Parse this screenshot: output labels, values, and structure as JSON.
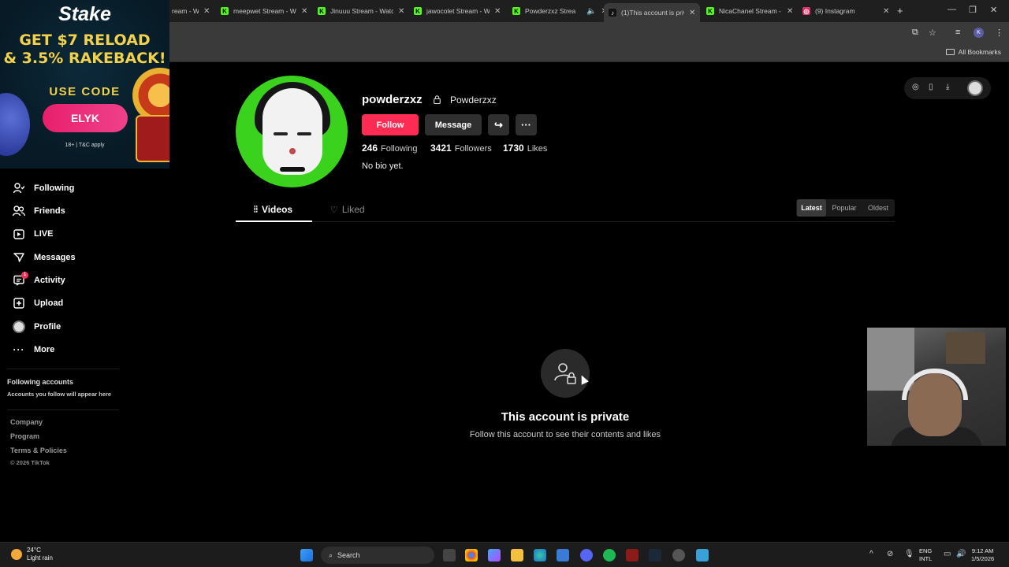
{
  "browser": {
    "tabs": [
      {
        "title": "ream - W",
        "fav_color": "#53fc18",
        "fav_glyph": ""
      },
      {
        "title": "meepwet Stream - W",
        "fav_color": "#53fc18",
        "fav_glyph": "K"
      },
      {
        "title": "Jinuuu Stream - Watc",
        "fav_color": "#53fc18",
        "fav_glyph": "K"
      },
      {
        "title": "jawocolet Stream - W",
        "fav_color": "#53fc18",
        "fav_glyph": "K"
      },
      {
        "title": "Powderzxz Strea",
        "fav_color": "#53fc18",
        "fav_glyph": "K"
      },
      {
        "title": "(1)This account is priv",
        "fav_color": "#000000",
        "fav_glyph": "♪"
      },
      {
        "title": "NicaChanel Stream -",
        "fav_color": "#53fc18",
        "fav_glyph": "K"
      },
      {
        "title": "(9) Instagram",
        "fav_color": "#e1306c",
        "fav_glyph": "◎"
      }
    ],
    "new_tab": "+",
    "all_bookmarks": "All Bookmarks",
    "avatar_letter": "K"
  },
  "ad": {
    "brand": "Stake",
    "headline_1": "GET $7 RELOAD",
    "headline_2": "& 3.5% RAKEBACK!",
    "code_label": "USE CODE",
    "code": "ELYK",
    "fine_print": "18+ | T&C apply"
  },
  "sidebar": {
    "items": [
      {
        "label": "Following",
        "icon": "following-icon"
      },
      {
        "label": "Friends",
        "icon": "friends-icon"
      },
      {
        "label": "LIVE",
        "icon": "live-icon"
      },
      {
        "label": "Messages",
        "icon": "messages-icon"
      },
      {
        "label": "Activity",
        "icon": "activity-icon",
        "badge": "1"
      },
      {
        "label": "Upload",
        "icon": "upload-icon"
      },
      {
        "label": "Profile",
        "icon": "profile-icon"
      },
      {
        "label": "More",
        "icon": "more-icon"
      }
    ],
    "following_title": "Following accounts",
    "following_sub": "Accounts you follow will appear here",
    "footer": [
      "Company",
      "Program",
      "Terms & Policies"
    ],
    "copyright": "© 2026 TikTok"
  },
  "profile": {
    "username": "powderzxz",
    "nickname": "Powderzxz",
    "follow_label": "Follow",
    "message_label": "Message",
    "following_count": "246",
    "following_label": "Following",
    "followers_count": "3421",
    "followers_label": "Followers",
    "likes_count": "1730",
    "likes_label": "Likes",
    "bio": "No bio yet.",
    "tab_videos": "Videos",
    "tab_liked": "Liked",
    "sort": [
      "Latest",
      "Popular",
      "Oldest"
    ],
    "sort_selected": "Latest",
    "private_title": "This account is private",
    "private_sub": "Follow this account to see their contents and likes"
  },
  "taskbar": {
    "temp": "24°C",
    "weather": "Light rain",
    "search": "Search",
    "lang_1": "ENG",
    "lang_2": "INTL",
    "time": "9:12 AM",
    "date": "1/5/2026"
  },
  "colors": {
    "accent": "#fe2c55",
    "avatar_bg": "#3ad21c",
    "ad_gold": "#f2d24b"
  }
}
